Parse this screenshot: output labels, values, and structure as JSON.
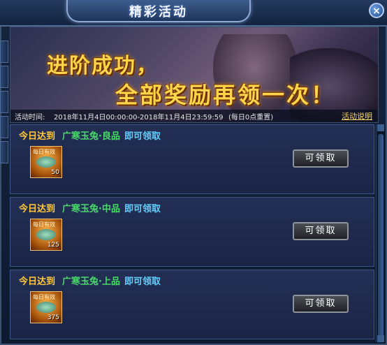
{
  "window": {
    "title": "精彩活动",
    "close_label": "×"
  },
  "banner": {
    "headline_1": "进阶成功，",
    "headline_2": "全部奖励再领一次！",
    "time_label": "活动时间:",
    "time_value": "2018年11月4日00:00:00-2018年11月4日23:59:59",
    "reset_note": "(每日0点重置)",
    "rules_link": "活动说明"
  },
  "rewards": [
    {
      "reach": "今日达到",
      "item_name": "广寒玉兔·良品",
      "claimable": "即可领取",
      "icon_tag": "每日有效",
      "count": "50",
      "button": "可领取"
    },
    {
      "reach": "今日达到",
      "item_name": "广寒玉兔·中品",
      "claimable": "即可领取",
      "icon_tag": "每日有效",
      "count": "125",
      "button": "可领取"
    },
    {
      "reach": "今日达到",
      "item_name": "广寒玉兔·上品",
      "claimable": "即可领取",
      "icon_tag": "每日有效",
      "count": "375",
      "button": "可领取"
    }
  ],
  "colors": {
    "accent_gold": "#ffd64a",
    "item_green": "#49d86a",
    "claim_blue": "#5fd0ff"
  }
}
